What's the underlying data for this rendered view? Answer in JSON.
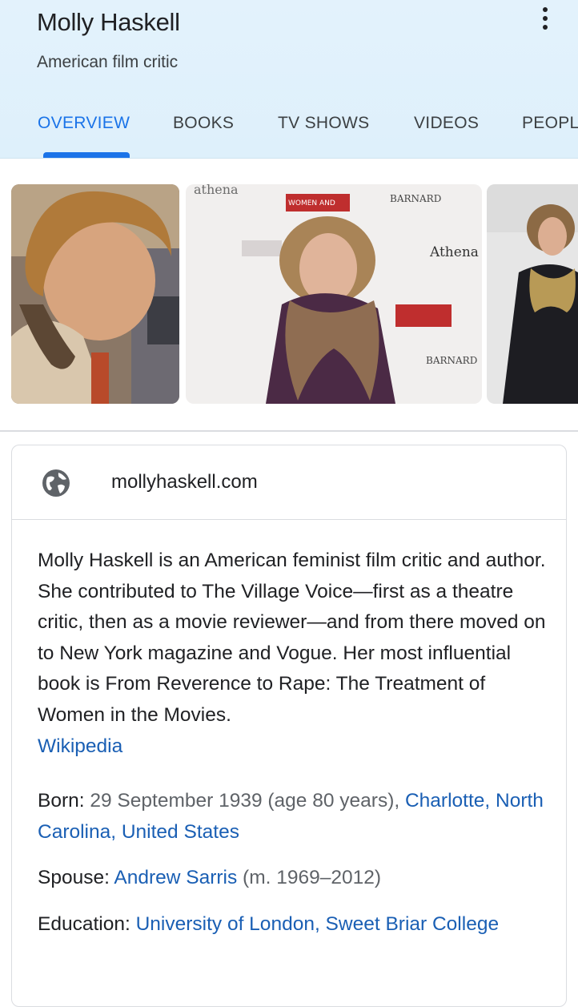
{
  "header": {
    "title": "Molly Haskell",
    "subtitle": "American film critic",
    "more_icon": "more-vert-icon"
  },
  "tabs": [
    {
      "label": "OVERVIEW",
      "active": true
    },
    {
      "label": "BOOKS",
      "active": false
    },
    {
      "label": "TV SHOWS",
      "active": false
    },
    {
      "label": "VIDEOS",
      "active": false
    },
    {
      "label": "PEOPLE",
      "active": false
    }
  ],
  "photos": {
    "photo2_texts": [
      "BARNARD",
      "Athena",
      "WOMEN AND",
      "BARNARD"
    ]
  },
  "card": {
    "globe_icon": "globe-icon",
    "website": "mollyhaskell.com",
    "description": "Molly Haskell is an American feminist film critic and author. She contributed to The Village Voice—first as a theatre critic, then as a movie reviewer—and from there moved on to New York magazine and Vogue. Her most influential book is From Reverence to Rape: The Treatment of Women in the Movies.",
    "source": "Wikipedia",
    "facts": {
      "born": {
        "label": "Born:",
        "value": "29 September 1939 (age 80 years),",
        "link": "Charlotte, North Carolina, United States"
      },
      "spouse": {
        "label": "Spouse:",
        "link": "Andrew Sarris",
        "value": "(m. 1969–2012)"
      },
      "education": {
        "label": "Education:",
        "link": "University of London, Sweet Briar College"
      }
    }
  },
  "colors": {
    "accent": "#1a73e8",
    "link": "#1a5fb4",
    "header_bg": "#e3f2fc"
  }
}
